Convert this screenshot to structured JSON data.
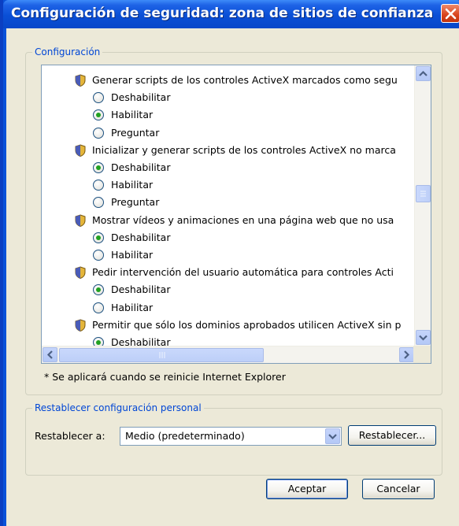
{
  "window": {
    "title": "Configuración de seguridad: zona de sitios de confianza"
  },
  "settings_group": {
    "legend": "Configuración",
    "items": [
      {
        "type": "category",
        "label": "Generar scripts de los controles ActiveX marcados como segu"
      },
      {
        "type": "option",
        "label": "Deshabilitar",
        "checked": false
      },
      {
        "type": "option",
        "label": "Habilitar",
        "checked": true
      },
      {
        "type": "option",
        "label": "Preguntar",
        "checked": false
      },
      {
        "type": "category",
        "label": "Inicializar y generar scripts de los controles ActiveX no marca"
      },
      {
        "type": "option",
        "label": "Deshabilitar",
        "checked": true
      },
      {
        "type": "option",
        "label": "Habilitar",
        "checked": false
      },
      {
        "type": "option",
        "label": "Preguntar",
        "checked": false
      },
      {
        "type": "category",
        "label": "Mostrar vídeos y animaciones en una página web que no usa"
      },
      {
        "type": "option",
        "label": "Deshabilitar",
        "checked": true
      },
      {
        "type": "option",
        "label": "Habilitar",
        "checked": false
      },
      {
        "type": "category",
        "label": "Pedir intervención del usuario automática para controles Acti"
      },
      {
        "type": "option",
        "label": "Deshabilitar",
        "checked": true
      },
      {
        "type": "option",
        "label": "Habilitar",
        "checked": false
      },
      {
        "type": "category",
        "label": "Permitir que sólo los dominios aprobados utilicen ActiveX sin p"
      },
      {
        "type": "option",
        "label": "Deshabilitar",
        "checked": true
      }
    ],
    "note": "* Se aplicará cuando se reinicie Internet Explorer",
    "vertical_scroll_position": 0.45
  },
  "reset_group": {
    "legend": "Restablecer configuración personal",
    "label": "Restablecer a:",
    "selected": "Medio (predeterminado)",
    "reset_button": "Restablecer..."
  },
  "buttons": {
    "ok": "Aceptar",
    "cancel": "Cancelar"
  }
}
